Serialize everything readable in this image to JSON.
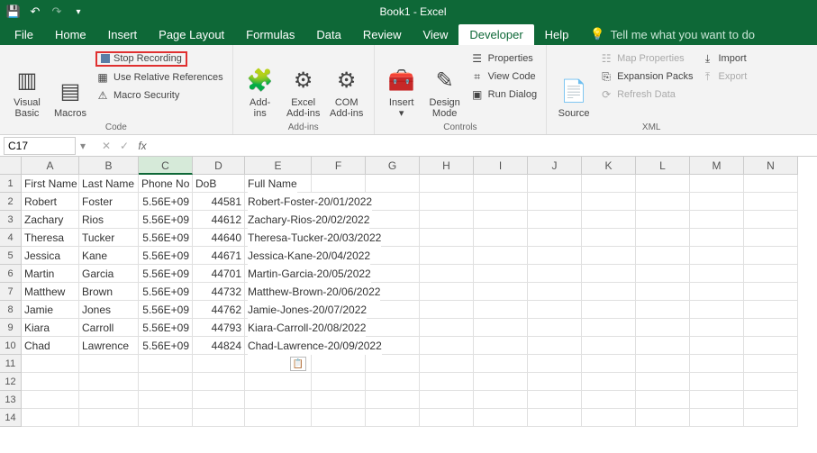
{
  "title": "Book1 - Excel",
  "tabs": [
    "File",
    "Home",
    "Insert",
    "Page Layout",
    "Formulas",
    "Data",
    "Review",
    "View",
    "Developer",
    "Help"
  ],
  "active_tab": "Developer",
  "tellme": "Tell me what you want to do",
  "ribbon": {
    "code": {
      "label": "Code",
      "visual_basic": "Visual\nBasic",
      "macros": "Macros",
      "stop_recording": "Stop Recording",
      "use_rel": "Use Relative References",
      "macro_sec": "Macro Security"
    },
    "addins": {
      "label": "Add-ins",
      "addins": "Add-\nins",
      "excel_addins": "Excel\nAdd-ins",
      "com_addins": "COM\nAdd-ins"
    },
    "controls": {
      "label": "Controls",
      "insert": "Insert",
      "design": "Design\nMode",
      "properties": "Properties",
      "view_code": "View Code",
      "run_dialog": "Run Dialog"
    },
    "xml": {
      "label": "XML",
      "source": "Source",
      "map_props": "Map Properties",
      "exp_packs": "Expansion Packs",
      "refresh": "Refresh Data",
      "import": "Import",
      "export": "Export"
    }
  },
  "namebox": "C17",
  "columns": [
    "A",
    "B",
    "C",
    "D",
    "E",
    "F",
    "G",
    "H",
    "I",
    "J",
    "K",
    "L",
    "M",
    "N"
  ],
  "colwidths": [
    "cw-A",
    "cw-B",
    "cw-C",
    "cw-D",
    "cw-E",
    "cw-F",
    "cw-G",
    "cw-H",
    "cw-I",
    "cw-J",
    "cw-K",
    "cw-L",
    "cw-M",
    "cw-N"
  ],
  "headers": {
    "A": "First Name",
    "B": "Last Name",
    "C": "Phone No",
    "D": "DoB",
    "E": "Full Name"
  },
  "rows": [
    {
      "A": "Robert",
      "B": "Foster",
      "C": "5.56E+09",
      "D": "44581",
      "E": "Robert-Foster-20/01/2022"
    },
    {
      "A": "Zachary",
      "B": "Rios",
      "C": "5.56E+09",
      "D": "44612",
      "E": "Zachary-Rios-20/02/2022"
    },
    {
      "A": "Theresa",
      "B": "Tucker",
      "C": "5.56E+09",
      "D": "44640",
      "E": "Theresa-Tucker-20/03/2022"
    },
    {
      "A": "Jessica",
      "B": "Kane",
      "C": "5.56E+09",
      "D": "44671",
      "E": "Jessica-Kane-20/04/2022"
    },
    {
      "A": "Martin",
      "B": "Garcia",
      "C": "5.56E+09",
      "D": "44701",
      "E": "Martin-Garcia-20/05/2022"
    },
    {
      "A": "Matthew",
      "B": "Brown",
      "C": "5.56E+09",
      "D": "44732",
      "E": "Matthew-Brown-20/06/2022"
    },
    {
      "A": "Jamie",
      "B": "Jones",
      "C": "5.56E+09",
      "D": "44762",
      "E": "Jamie-Jones-20/07/2022"
    },
    {
      "A": "Kiara",
      "B": "Carroll",
      "C": "5.56E+09",
      "D": "44793",
      "E": "Kiara-Carroll-20/08/2022"
    },
    {
      "A": "Chad",
      "B": "Lawrence",
      "C": "5.56E+09",
      "D": "44824",
      "E": "Chad-Lawrence-20/09/2022"
    }
  ],
  "empty_rows": [
    11,
    12,
    13,
    14
  ]
}
